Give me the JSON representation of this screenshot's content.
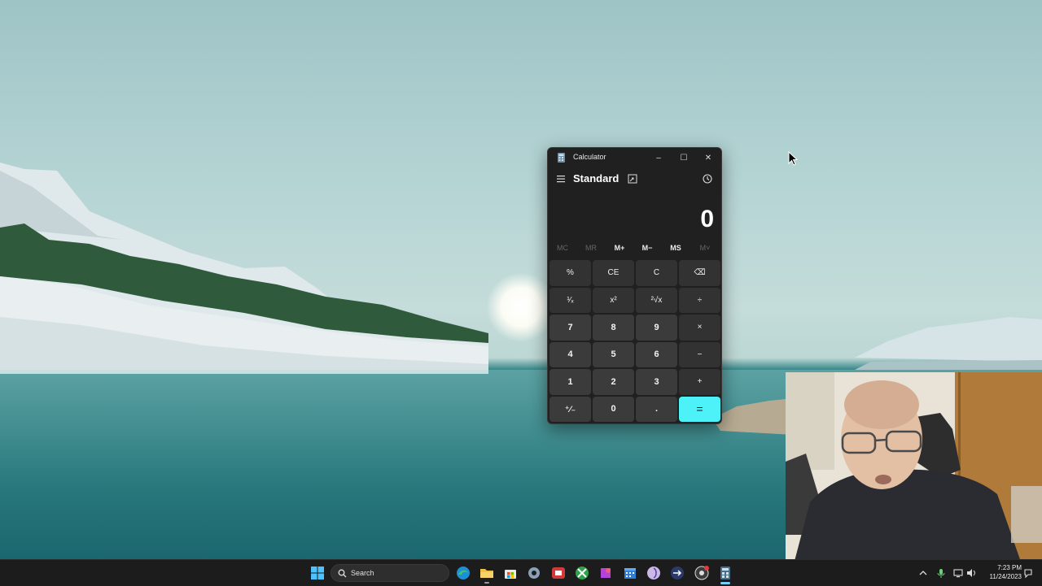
{
  "calculator": {
    "title": "Calculator",
    "mode": "Standard",
    "display": "0",
    "window_buttons": {
      "minimize": "–",
      "maximize": "☐",
      "close": "✕"
    },
    "memory": [
      {
        "label": "MC",
        "enabled": false
      },
      {
        "label": "MR",
        "enabled": false
      },
      {
        "label": "M+",
        "enabled": true
      },
      {
        "label": "M−",
        "enabled": true
      },
      {
        "label": "MS",
        "enabled": true
      },
      {
        "label": "M˅",
        "enabled": false
      }
    ],
    "keys": [
      {
        "label": "%",
        "name": "percent-key",
        "type": "fn"
      },
      {
        "label": "CE",
        "name": "clear-entry-key",
        "type": "fn"
      },
      {
        "label": "C",
        "name": "clear-key",
        "type": "fn"
      },
      {
        "label": "⌫",
        "name": "backspace-key",
        "type": "fn"
      },
      {
        "label": "¹⁄ₓ",
        "name": "reciprocal-key",
        "type": "fn"
      },
      {
        "label": "x²",
        "name": "square-key",
        "type": "fn"
      },
      {
        "label": "²√x",
        "name": "square-root-key",
        "type": "fn"
      },
      {
        "label": "÷",
        "name": "divide-key",
        "type": "fn"
      },
      {
        "label": "7",
        "name": "digit-7-key",
        "type": "num"
      },
      {
        "label": "8",
        "name": "digit-8-key",
        "type": "num"
      },
      {
        "label": "9",
        "name": "digit-9-key",
        "type": "num"
      },
      {
        "label": "×",
        "name": "multiply-key",
        "type": "fn"
      },
      {
        "label": "4",
        "name": "digit-4-key",
        "type": "num"
      },
      {
        "label": "5",
        "name": "digit-5-key",
        "type": "num"
      },
      {
        "label": "6",
        "name": "digit-6-key",
        "type": "num"
      },
      {
        "label": "−",
        "name": "subtract-key",
        "type": "fn"
      },
      {
        "label": "1",
        "name": "digit-1-key",
        "type": "num"
      },
      {
        "label": "2",
        "name": "digit-2-key",
        "type": "num"
      },
      {
        "label": "3",
        "name": "digit-3-key",
        "type": "num"
      },
      {
        "label": "+",
        "name": "add-key",
        "type": "fn"
      },
      {
        "label": "⁺⁄₋",
        "name": "negate-key",
        "type": "num"
      },
      {
        "label": "0",
        "name": "digit-0-key",
        "type": "num"
      },
      {
        "label": ".",
        "name": "decimal-key",
        "type": "num"
      },
      {
        "label": "=",
        "name": "equals-key",
        "type": "equals"
      }
    ],
    "accent_color": "#4cf2f7"
  },
  "taskbar": {
    "search_label": "Search",
    "clock_time": "7:23 PM",
    "clock_date": "11/24/2023",
    "pinned_icons": [
      "windows-start-icon",
      "edge-icon",
      "file-explorer-icon",
      "store-icon",
      "settings-icon",
      "media-app-icon",
      "xbox-icon",
      "paint-app-icon",
      "calendar-app-icon",
      "spiral-app-icon",
      "arrow-app-icon",
      "chrome-icon",
      "calculator-icon"
    ],
    "tray_icons": [
      "chevron-up-icon",
      "microphone-icon",
      "network-icon",
      "volume-icon",
      "notification-icon"
    ]
  },
  "desktop": {
    "wallpaper": "lake-mountains-sunrise",
    "webcam_overlay": "presenter-webcam"
  }
}
